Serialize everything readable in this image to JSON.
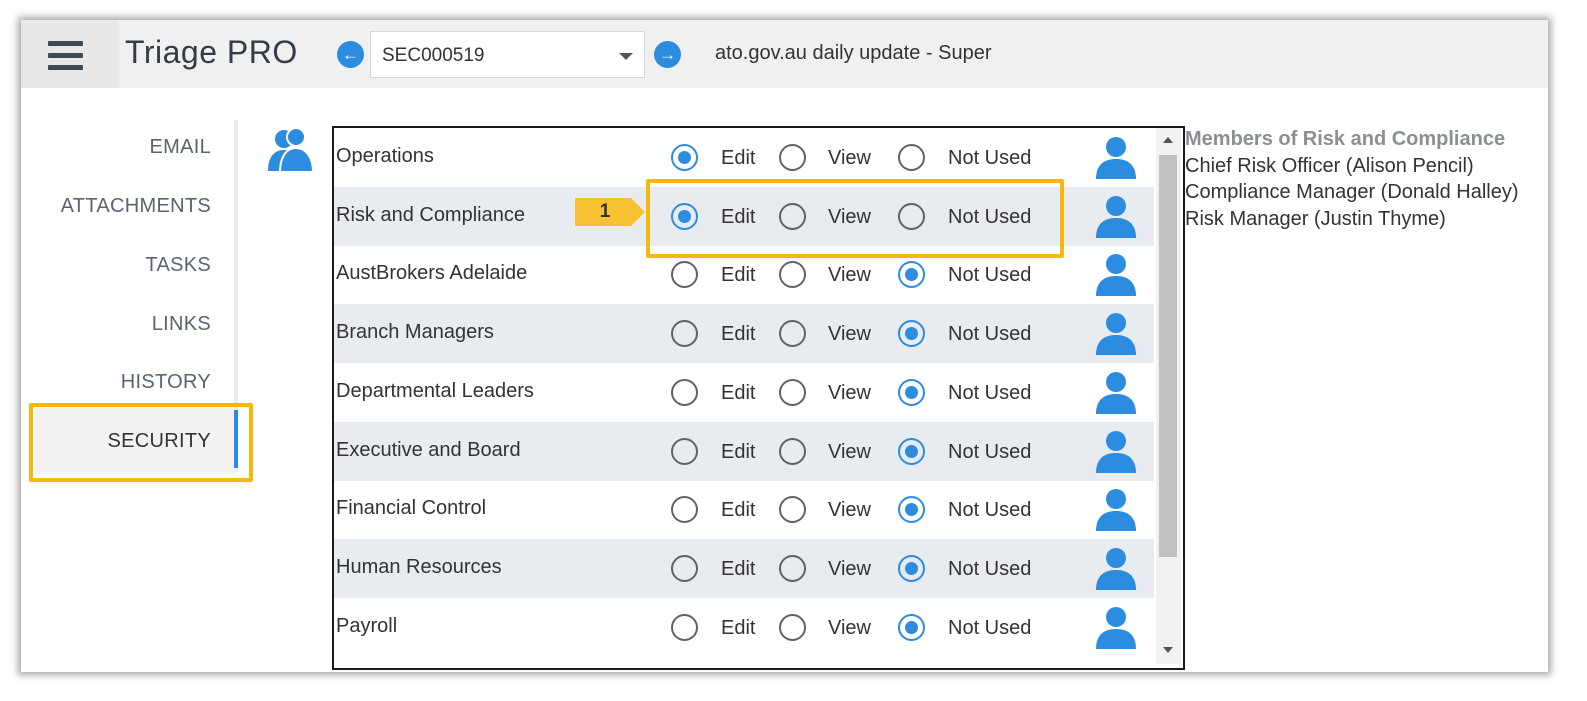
{
  "header": {
    "app_title": "Triage PRO",
    "record_id": "SEC000519",
    "subject": "ato.gov.au daily update - Super",
    "prev_arrow": "←",
    "next_arrow": "→"
  },
  "sidebar": {
    "items": [
      {
        "label": "EMAIL"
      },
      {
        "label": "ATTACHMENTS"
      },
      {
        "label": "TASKS"
      },
      {
        "label": "LINKS"
      },
      {
        "label": "HISTORY"
      },
      {
        "label": "SECURITY",
        "active": true
      }
    ]
  },
  "permission_options": [
    "Edit",
    "View",
    "Not Used"
  ],
  "rows": [
    {
      "name": "Operations",
      "selected": "Edit"
    },
    {
      "name": "Risk and Compliance",
      "selected": "Edit"
    },
    {
      "name": "AustBrokers Adelaide",
      "selected": "Not Used"
    },
    {
      "name": "Branch Managers",
      "selected": "Not Used"
    },
    {
      "name": "Departmental Leaders",
      "selected": "Not Used"
    },
    {
      "name": "Executive and Board",
      "selected": "Not Used"
    },
    {
      "name": "Financial Control",
      "selected": "Not Used"
    },
    {
      "name": "Human Resources",
      "selected": "Not Used"
    },
    {
      "name": "Payroll",
      "selected": "Not Used"
    }
  ],
  "callout": {
    "number": "1"
  },
  "members": {
    "title": "Members of Risk and Compliance",
    "list": [
      "Chief Risk Officer (Alison Pencil)",
      "Compliance Manager (Donald Halley)",
      "Risk Manager (Justin Thyme)"
    ]
  },
  "colors": {
    "accent": "#2c8ce0",
    "highlight": "#f6b80d",
    "row_alt": "#e8ebef"
  },
  "icons": {
    "menu": "hamburger-icon",
    "group": "group-users-icon",
    "person": "person-icon"
  }
}
